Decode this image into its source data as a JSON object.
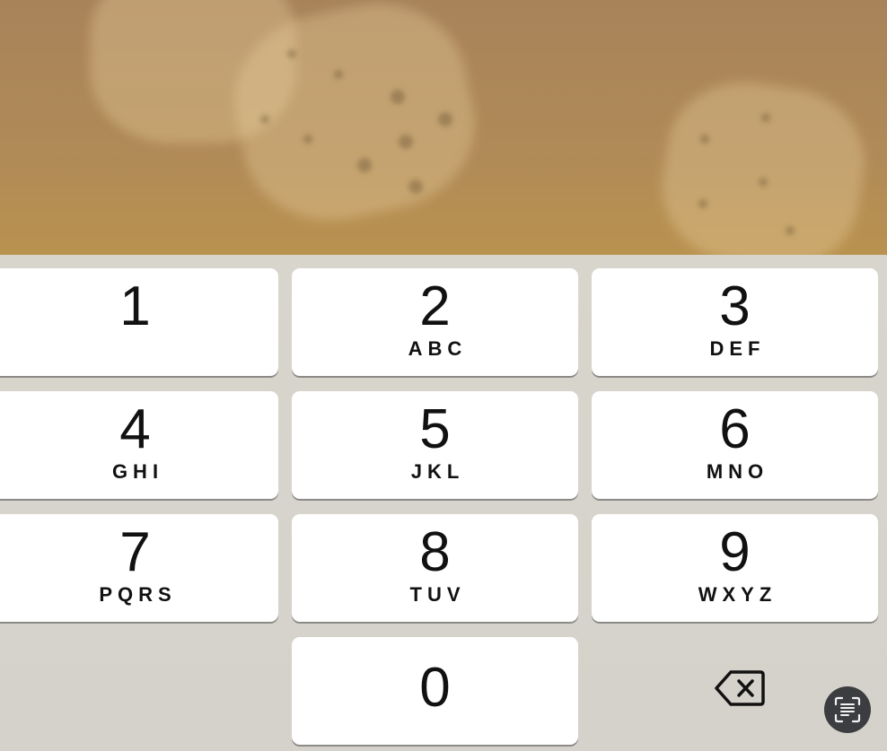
{
  "keypad": {
    "keys": [
      {
        "digit": "1",
        "letters": ""
      },
      {
        "digit": "2",
        "letters": "ABC"
      },
      {
        "digit": "3",
        "letters": "DEF"
      },
      {
        "digit": "4",
        "letters": "GHI"
      },
      {
        "digit": "5",
        "letters": "JKL"
      },
      {
        "digit": "6",
        "letters": "MNO"
      },
      {
        "digit": "7",
        "letters": "PQRS"
      },
      {
        "digit": "8",
        "letters": "TUV"
      },
      {
        "digit": "9",
        "letters": "WXYZ"
      },
      {
        "digit": "0",
        "letters": ""
      }
    ],
    "delete_icon": "backspace-icon",
    "scan_icon": "text-scan-icon"
  },
  "colors": {
    "key_background": "#ffffff",
    "keypad_background": "#d7d4cc",
    "scan_button": "#3b3d40"
  }
}
